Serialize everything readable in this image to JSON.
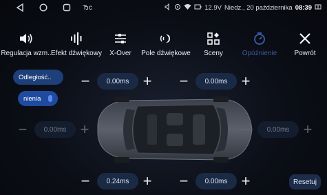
{
  "status": {
    "bluetooth": "Ђc",
    "voltage": "12.9V",
    "date": "Niedz., 20 października",
    "time": "08:39"
  },
  "toolbar": {
    "items": [
      {
        "label": "Regulacja wzm..",
        "icon": "speaker-volume-icon"
      },
      {
        "label": "Efekt dźwiękowy",
        "icon": "equalizer-icon"
      },
      {
        "label": "X-Over",
        "icon": "crossover-icon"
      },
      {
        "label": "Pole dźwiękowe",
        "icon": "sound-field-icon"
      },
      {
        "label": "Sceny",
        "icon": "scenes-icon"
      },
      {
        "label": "Opóźnienie",
        "icon": "timer-icon",
        "active": true
      },
      {
        "label": "Powrót",
        "icon": "close-icon"
      }
    ]
  },
  "toggles": {
    "distance": "Odległość..",
    "delay": "nienia"
  },
  "delays": {
    "front_left": "0.00ms",
    "front_right": "0.00ms",
    "mid_left": "0.00ms",
    "mid_right": "0.00ms",
    "rear_left": "0.24ms",
    "rear_right": "0.00ms"
  },
  "reset_label": "Resetuj",
  "colors": {
    "accent": "#1e4aa0",
    "active_tab": "#3c5a9c",
    "value_bg": "#1b2a44"
  }
}
